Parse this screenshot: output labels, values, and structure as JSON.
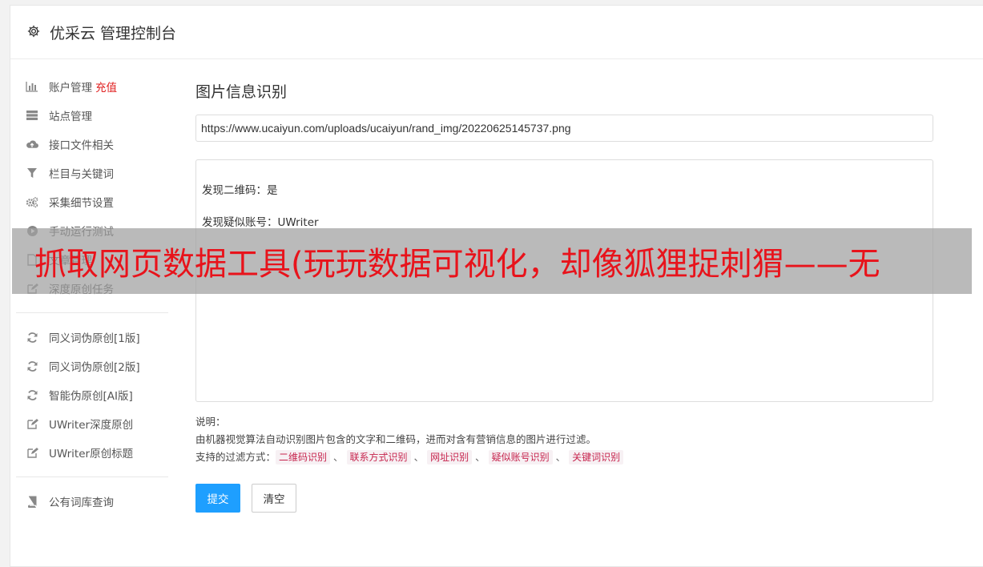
{
  "header": {
    "title": "优采云 管理控制台",
    "icon": "gear-icon"
  },
  "sidebar": {
    "group1": [
      {
        "label": "账户管理",
        "extra": "充值",
        "icon": "bar-chart-icon"
      },
      {
        "label": "站点管理",
        "icon": "server-icon"
      },
      {
        "label": "接口文件相关",
        "icon": "cloud-upload-icon"
      },
      {
        "label": "栏目与关键词",
        "icon": "filter-icon"
      },
      {
        "label": "采集细节设置",
        "icon": "gears-icon"
      },
      {
        "label": "手动运行测试",
        "icon": "play-circle-icon"
      },
      {
        "label": "文章管理",
        "icon": "file-icon"
      },
      {
        "label": "深度原创任务",
        "icon": "edit-icon"
      }
    ],
    "group2": [
      {
        "label": "同义词伪原创[1版]",
        "icon": "refresh-icon"
      },
      {
        "label": "同义词伪原创[2版]",
        "icon": "refresh-icon"
      },
      {
        "label": "智能伪原创[AI版]",
        "icon": "refresh-icon"
      },
      {
        "label": "UWriter深度原创",
        "icon": "edit-icon"
      },
      {
        "label": "UWriter原创标题",
        "icon": "edit-icon"
      }
    ],
    "group3": [
      {
        "label": "公有词库查询",
        "icon": "book-icon"
      }
    ]
  },
  "main": {
    "title": "图片信息识别",
    "url_value": "https://www.ucaiyun.com/uploads/ucaiyun/rand_img/20220625145737.png",
    "result_lines": [
      "发现二维码：是",
      "发现疑似账号：UWriter"
    ],
    "desc_label": "说明：",
    "desc_text": "由机器视觉算法自动识别图片包含的文字和二维码，进而对含有营销信息的图片进行过滤。",
    "filters_label": "支持的过滤方式：",
    "filters": [
      "二维码识别",
      "联系方式识别",
      "网址识别",
      "疑似账号识别",
      "关键词识别"
    ],
    "separator": "、",
    "submit_label": "提交",
    "clear_label": "清空"
  },
  "overlay": {
    "text": "抓取网页数据工具(玩玩数据可视化，却像狐狸捉刺猬——无"
  }
}
